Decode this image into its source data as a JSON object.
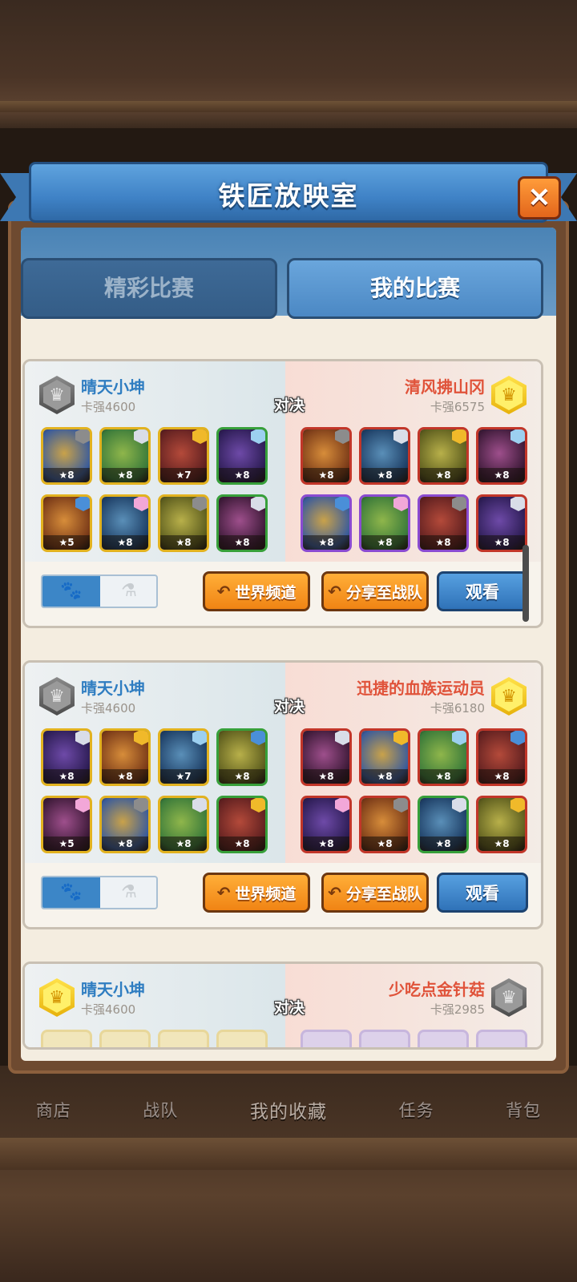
{
  "title": "铁匠放映室",
  "close_icon": "×",
  "tabs": [
    {
      "label": "精彩比赛",
      "active": false
    },
    {
      "label": "我的比赛",
      "active": true
    }
  ],
  "bottom_nav": [
    "商店",
    "战队",
    "我的收藏",
    "任务",
    "背包"
  ],
  "vs_label": "对决",
  "buttons": {
    "world_channel": "世界频道",
    "share_team": "分享至战队",
    "watch": "观看"
  },
  "toggle": {
    "on_icon": "paw-icon",
    "off_icon": "potion-icon"
  },
  "matches": [
    {
      "left": {
        "name": "晴天小坤",
        "power": "卡强4600",
        "rank": "silver",
        "heroes": [
          {
            "star": "★8",
            "frame": "gold"
          },
          {
            "star": "★8",
            "frame": "gold"
          },
          {
            "star": "★7",
            "frame": "gold"
          },
          {
            "star": "★8",
            "frame": "green"
          },
          {
            "star": "★5",
            "frame": "gold"
          },
          {
            "star": "★8",
            "frame": "gold"
          },
          {
            "star": "★8",
            "frame": "gold"
          },
          {
            "star": "★8",
            "frame": "green"
          }
        ]
      },
      "right": {
        "name": "清风拂山冈",
        "power": "卡强6575",
        "rank": "gold",
        "heroes": [
          {
            "star": "★8",
            "frame": "red"
          },
          {
            "star": "★8",
            "frame": "red"
          },
          {
            "star": "★8",
            "frame": "red"
          },
          {
            "star": "★8",
            "frame": "red"
          },
          {
            "star": "★8",
            "frame": "purple"
          },
          {
            "star": "★8",
            "frame": "purple"
          },
          {
            "star": "★8",
            "frame": "purple"
          },
          {
            "star": "★8",
            "frame": "red"
          }
        ]
      }
    },
    {
      "left": {
        "name": "晴天小坤",
        "power": "卡强4600",
        "rank": "silver",
        "heroes": [
          {
            "star": "★8",
            "frame": "gold"
          },
          {
            "star": "★8",
            "frame": "gold"
          },
          {
            "star": "★7",
            "frame": "gold"
          },
          {
            "star": "★8",
            "frame": "green"
          },
          {
            "star": "★5",
            "frame": "gold"
          },
          {
            "star": "★8",
            "frame": "gold"
          },
          {
            "star": "★8",
            "frame": "gold"
          },
          {
            "star": "★8",
            "frame": "green"
          }
        ]
      },
      "right": {
        "name": "迅捷的血族运动员",
        "power": "卡强6180",
        "rank": "gold",
        "heroes": [
          {
            "star": "★8",
            "frame": "red"
          },
          {
            "star": "★8",
            "frame": "red"
          },
          {
            "star": "★8",
            "frame": "red"
          },
          {
            "star": "★8",
            "frame": "red"
          },
          {
            "star": "★8",
            "frame": "red"
          },
          {
            "star": "★8",
            "frame": "red"
          },
          {
            "star": "★8",
            "frame": "green"
          },
          {
            "star": "★8",
            "frame": "red"
          }
        ]
      }
    },
    {
      "left": {
        "name": "晴天小坤",
        "power": "卡强4600",
        "rank": "gold"
      },
      "right": {
        "name": "少吃点金针菇",
        "power": "卡强2985",
        "rank": "silver"
      }
    }
  ]
}
